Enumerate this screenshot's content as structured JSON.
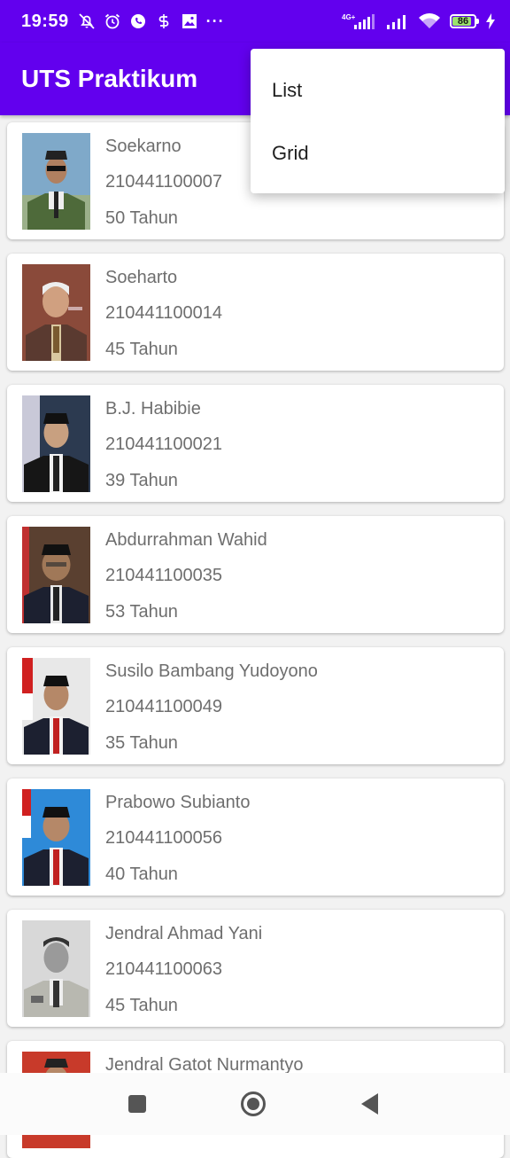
{
  "status_bar": {
    "time": "19:59",
    "more_dots": "···",
    "network_label": "4G+",
    "battery": "86",
    "icons": [
      "mute-icon",
      "alarm-icon",
      "whatsapp-icon",
      "app-icon",
      "gallery-icon",
      "signal-icon",
      "wifi-icon",
      "charging-icon"
    ]
  },
  "app_bar": {
    "title": "UTS Praktikum"
  },
  "menu": {
    "items": [
      {
        "label": "List"
      },
      {
        "label": "Grid"
      }
    ]
  },
  "people": [
    {
      "name": "Soekarno",
      "nim": "210441100007",
      "age": "50 Tahun"
    },
    {
      "name": "Soeharto",
      "nim": "210441100014",
      "age": "45 Tahun"
    },
    {
      "name": "B.J. Habibie",
      "nim": "210441100021",
      "age": "39 Tahun"
    },
    {
      "name": "Abdurrahman Wahid",
      "nim": "210441100035",
      "age": "53 Tahun"
    },
    {
      "name": "Susilo Bambang Yudoyono",
      "nim": "210441100049",
      "age": "35 Tahun"
    },
    {
      "name": "Prabowo Subianto",
      "nim": "210441100056",
      "age": "40 Tahun"
    },
    {
      "name": "Jendral Ahmad Yani",
      "nim": "210441100063",
      "age": "45 Tahun"
    },
    {
      "name": "Jendral Gatot Nurmantyo",
      "nim": "",
      "age": ""
    }
  ],
  "nav_bar": {
    "buttons": [
      "recents-button",
      "home-button",
      "back-button"
    ]
  },
  "colors": {
    "primary": "#6200ee",
    "card_text": "#6e6e6e",
    "background": "#f2f2f2"
  }
}
